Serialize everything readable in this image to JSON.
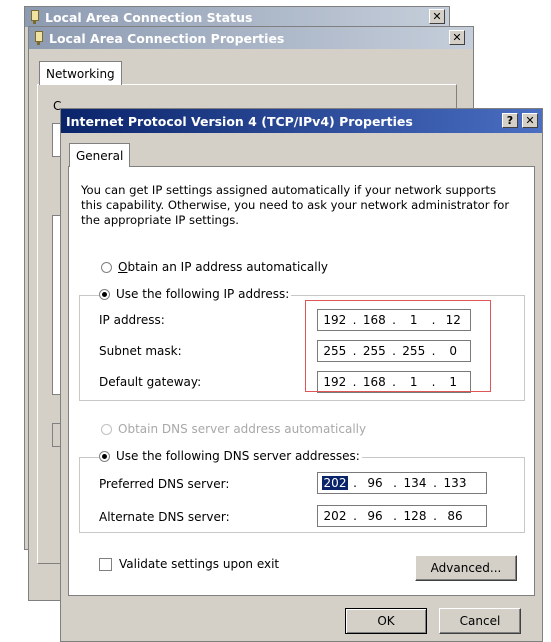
{
  "back_window": {
    "title": "Local Area Connection Status"
  },
  "mid_window": {
    "title": "Local Area Connection Properties",
    "tab": "Networking",
    "partial_labels": [
      "C",
      "T"
    ]
  },
  "dialog": {
    "title": "Internet Protocol Version 4 (TCP/IPv4) Properties",
    "help_glyph": "?",
    "close_glyph": "✕",
    "tab": "General",
    "intro": "You can get IP settings assigned automatically if your network supports this capability. Otherwise, you need to ask your network administrator for the appropriate IP settings.",
    "ip_section": {
      "auto_option": "Obtain an IP address automatically",
      "manual_option": "Use the following IP address:",
      "auto_selected": false,
      "manual_selected": true,
      "fields": [
        {
          "label": "IP address:",
          "octets": [
            "192",
            "168",
            "1",
            "12"
          ]
        },
        {
          "label": "Subnet mask:",
          "octets": [
            "255",
            "255",
            "255",
            "0"
          ]
        },
        {
          "label": "Default gateway:",
          "octets": [
            "192",
            "168",
            "1",
            "1"
          ]
        }
      ]
    },
    "dns_section": {
      "auto_option": "Obtain DNS server address automatically",
      "manual_option": "Use the following DNS server addresses:",
      "auto_enabled": false,
      "manual_selected": true,
      "fields": [
        {
          "label": "Preferred DNS server:",
          "octets": [
            "202",
            "96",
            "134",
            "133"
          ]
        },
        {
          "label": "Alternate DNS server:",
          "octets": [
            "202",
            "96",
            "128",
            "86"
          ]
        }
      ]
    },
    "validate_label": "Validate settings upon exit",
    "validate_checked": false,
    "advanced_button": "Advanced...",
    "ok_button": "OK",
    "cancel_button": "Cancel"
  },
  "colors": {
    "dialog_face": "#d4d0c8",
    "active_title": "#0a246a",
    "inactive_title": "#8d9bb2",
    "highlight_box": "#e05656",
    "selection": "#0a246a"
  }
}
